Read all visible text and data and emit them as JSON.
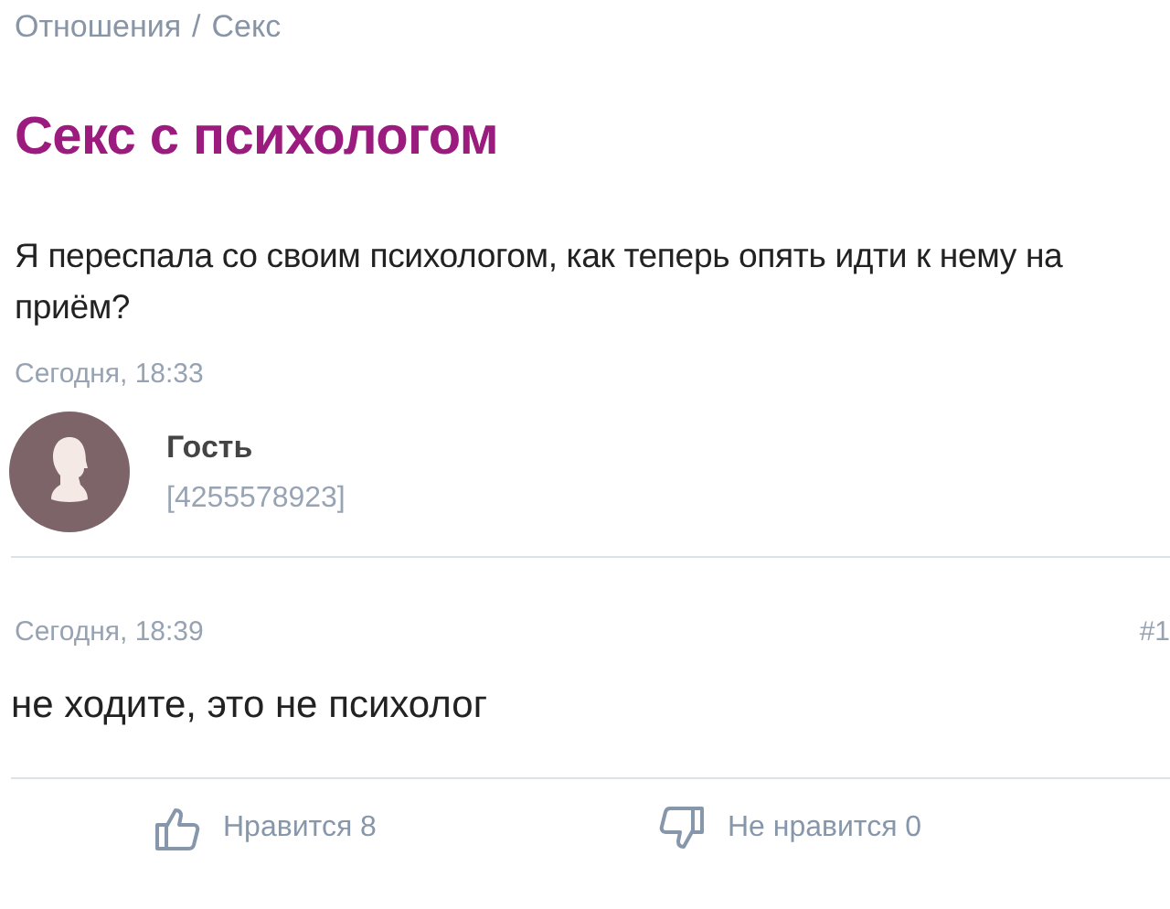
{
  "breadcrumb": {
    "items": [
      "Отношения",
      "Секс"
    ],
    "separator": "/"
  },
  "topic": {
    "title": "Секс с психологом",
    "text": "Я переспала со своим психологом, как теперь опять идти к нему на приём?",
    "time": "Сегодня, 18:33"
  },
  "author": {
    "name": "Гость",
    "id": "[4255578923]"
  },
  "comment": {
    "time": "Сегодня, 18:39",
    "number": "#1",
    "text": "не ходите, это не психолог"
  },
  "reactions": [
    {
      "kind": "like",
      "label": "Нравится 8"
    },
    {
      "kind": "dislike",
      "label": "Не нравится 0"
    }
  ]
}
